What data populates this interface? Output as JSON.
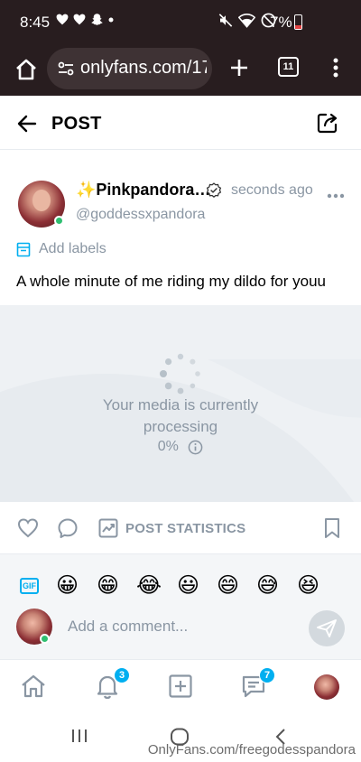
{
  "status_bar": {
    "time": "8:45",
    "battery_percent": "7%",
    "left_icons": [
      "heart-icon",
      "heart-icon",
      "snapchat-icon",
      "dot-icon"
    ],
    "right_icons": [
      "mute-icon",
      "wifi-icon",
      "do-not-disturb-icon",
      "battery-icon"
    ]
  },
  "browser": {
    "url": "onlyfans.com/17",
    "tab_count": "11"
  },
  "header": {
    "title": "POST"
  },
  "post": {
    "author_name": "✨Pinkpandora…",
    "author_handle": "@goddessxpandora",
    "timestamp": "seconds ago",
    "add_labels": "Add labels",
    "text": "A whole minute of me riding my dildo for youu",
    "media": {
      "message_line1": "Your media is currently",
      "message_line2": "processing",
      "progress_label": "0%",
      "progress": 0
    }
  },
  "actions": {
    "stats_label": "POST STATISTICS"
  },
  "emoji_bar": {
    "gif_label": "GIF",
    "emojis": [
      "😀",
      "😁",
      "😂",
      "😃",
      "😄",
      "😅",
      "😆"
    ]
  },
  "comment": {
    "placeholder": "Add a comment..."
  },
  "bottom_nav": {
    "notifications_badge": "3",
    "messages_badge": "7"
  },
  "watermark": "OnlyFans.com/freegodesspandora",
  "colors": {
    "accent": "#00aff0",
    "muted_text": "#8a96a3",
    "online": "#2fbf71",
    "chrome_bg": "#281d1f"
  }
}
